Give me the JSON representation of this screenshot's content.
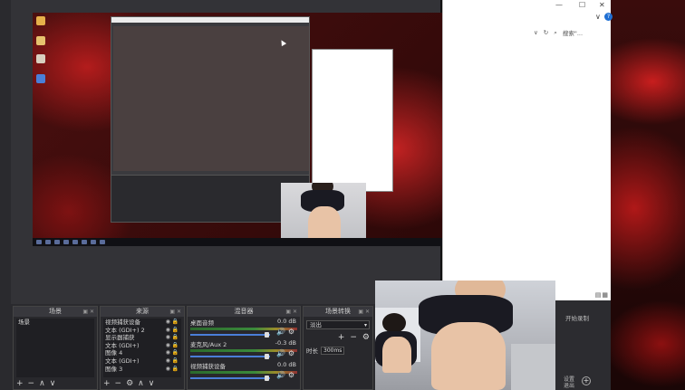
{
  "docks": {
    "scenes": {
      "title": "场景",
      "items": [
        "场景"
      ]
    },
    "sources": {
      "title": "来源",
      "items": [
        "视频捕获设备",
        "文本 (GDI+) 2",
        "显示器捕获",
        "文本 (GDI+)",
        "图像 4",
        "文本 (GDI+)",
        "图像 3"
      ]
    },
    "mixer": {
      "title": "混音器",
      "channels": [
        {
          "name": "桌面音频",
          "db": "0.0 dB",
          "muted": false
        },
        {
          "name": "麦克风/Aux 2",
          "db": "-0.3 dB",
          "muted": false
        },
        {
          "name": "视频捕获设备",
          "db": "0.0 dB",
          "muted": true
        }
      ]
    },
    "transitions": {
      "title": "场景转换",
      "selected": "淡出",
      "duration_label": "时长",
      "duration_value": "300ms"
    }
  },
  "explorer": {
    "search_placeholder": "搜索\"..."
  },
  "side": {
    "label1": "开始录制",
    "label2_line1": "设置",
    "label2_line2": "退出"
  },
  "icons": {
    "add": "+",
    "remove": "−",
    "up": "∧",
    "down": "∨",
    "gear": "⚙",
    "speaker": "🔊"
  }
}
